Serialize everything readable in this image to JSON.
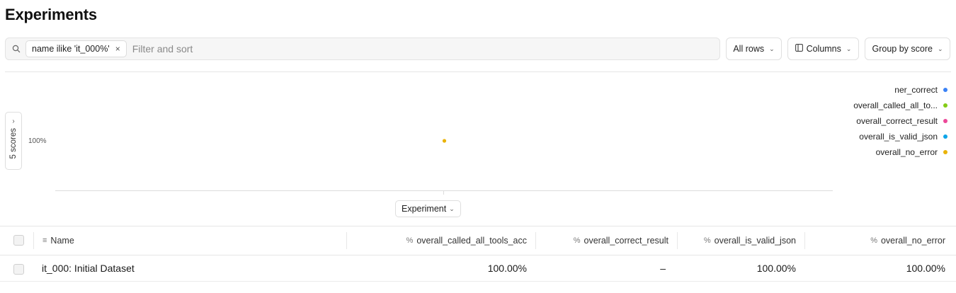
{
  "page": {
    "title": "Experiments"
  },
  "toolbar": {
    "filter_chip": "name ilike 'it_000%'",
    "filter_chip_remove": "×",
    "search_placeholder": "Filter and sort",
    "rows_button": "All rows",
    "columns_button": "Columns",
    "group_button": "Group by score"
  },
  "chart": {
    "scores_toggle_label": "5 scores",
    "x_selector": "Experiment"
  },
  "chart_data": {
    "type": "scatter",
    "y_tick_labels": [
      "100%"
    ],
    "x_axis_selector": "Experiment",
    "series": [
      {
        "name": "ner_correct",
        "color": "#3b82f6",
        "values": []
      },
      {
        "name": "overall_called_all_to...",
        "color": "#84cc16",
        "values": []
      },
      {
        "name": "overall_correct_result",
        "color": "#ec4899",
        "values": []
      },
      {
        "name": "overall_is_valid_json",
        "color": "#0ea5e9",
        "values": []
      },
      {
        "name": "overall_no_error",
        "color": "#eab308",
        "values": [
          1.0
        ]
      }
    ],
    "categories": [
      "it_000: Initial Dataset"
    ],
    "legend_position": "right",
    "grid": false
  },
  "table": {
    "columns": [
      {
        "label": "Name",
        "icon": "≡"
      },
      {
        "label": "overall_called_all_tools_acc",
        "icon": "%"
      },
      {
        "label": "overall_correct_result",
        "icon": "%"
      },
      {
        "label": "overall_is_valid_json",
        "icon": "%"
      },
      {
        "label": "overall_no_error",
        "icon": "%"
      }
    ],
    "rows": [
      {
        "name": "it_000: Initial Dataset",
        "called_all_tools": "100.00%",
        "correct_result": "–",
        "valid_json": "100.00%",
        "no_error": "100.00%"
      }
    ]
  }
}
